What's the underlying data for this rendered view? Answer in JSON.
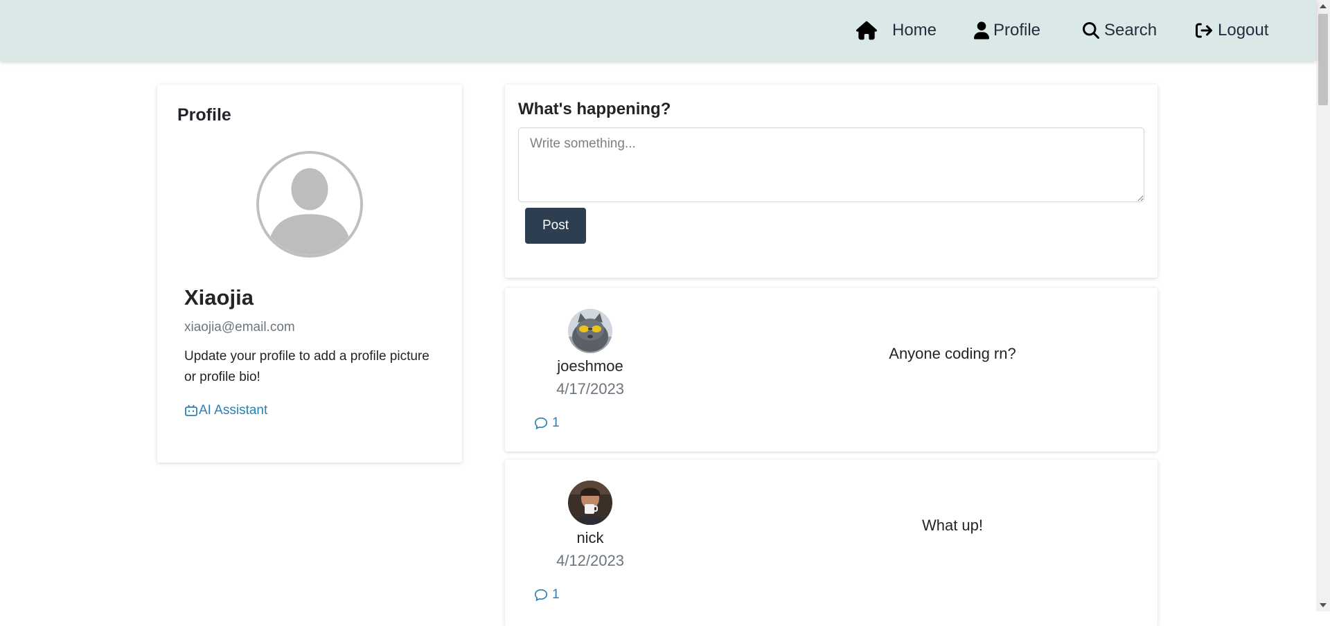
{
  "nav": {
    "home_label": "Home",
    "profile_label": "Profile",
    "search_label": "Search",
    "logout_label": "Logout",
    "bg_color": "#dae8e7"
  },
  "profile": {
    "heading": "Profile",
    "name": "Xiaojia",
    "email": "xiaojia@email.com",
    "bio": "Update your profile to add a profile picture or profile bio!",
    "ai_link_label": "AI Assistant",
    "avatar_icon": "default-user-icon"
  },
  "composer": {
    "title": "What's happening?",
    "placeholder": "Write something...",
    "value": "",
    "post_label": "Post",
    "button_color": "#2c3e50"
  },
  "posts": [
    {
      "username": "joeshmoe",
      "date": "4/17/2023",
      "text": "Anyone coding rn?",
      "comment_count": "1",
      "avatar_icon": "cat-with-sunglasses-avatar"
    },
    {
      "username": "nick",
      "date": "4/12/2023",
      "text": "What up!",
      "comment_count": "1",
      "avatar_icon": "man-drinking-coffee-avatar"
    }
  ],
  "colors": {
    "link": "#2a7fb0",
    "muted": "#6c757d"
  }
}
